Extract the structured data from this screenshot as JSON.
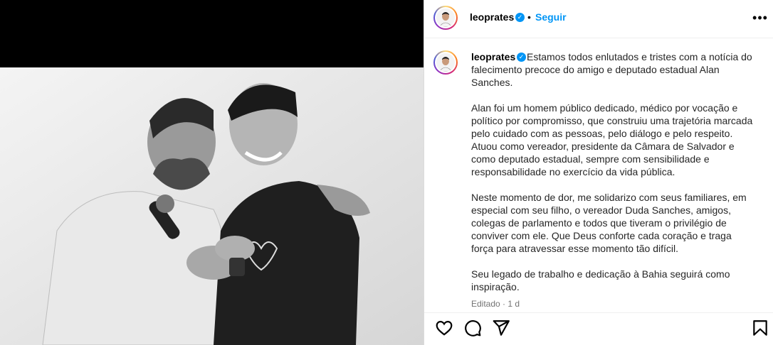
{
  "post": {
    "username": "leoprates",
    "follow_label": "Seguir",
    "separator": "•",
    "more_label": "•••",
    "caption_paragraphs": [
      "Estamos todos enlutados e tristes com a notícia do falecimento precoce do amigo e deputado estadual Alan Sanches.",
      "Alan foi um homem público dedicado, médico por vocação e político por compromisso, que construiu uma trajetória marcada pelo cuidado com as pessoas, pelo diálogo e pelo respeito. Atuou como vereador, presidente da Câmara de Salvador e como deputado estadual, sempre com sensibilidade e responsabilidade no exercício da vida pública.",
      "Neste momento de dor, me solidarizo com seus familiares, em especial com seu filho, o vereador Duda Sanches, amigos, colegas de parlamento e todos que tiveram o privilégio de conviver com ele. Que Deus conforte cada coração e traga força para atravessar esse momento tão difícil.",
      "Seu legado de trabalho e dedicação à Bahia seguirá como inspiração."
    ],
    "meta": "Editado · 1 d"
  },
  "icons": {
    "verified": "verified-badge-icon",
    "like": "heart-icon",
    "comment": "comment-icon",
    "share": "paper-plane-icon",
    "save": "bookmark-icon",
    "more": "more-options-icon"
  },
  "colors": {
    "link": "#0095f6",
    "text": "#262626",
    "muted": "#737373",
    "border": "#dbdbdb"
  }
}
